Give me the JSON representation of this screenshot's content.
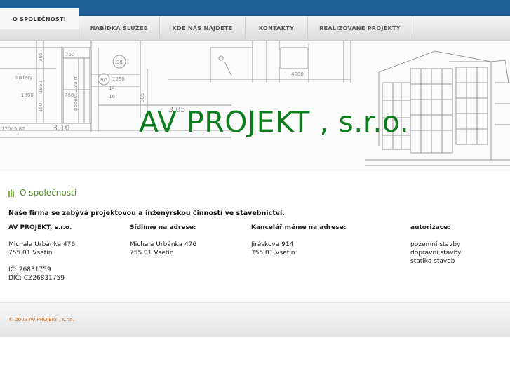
{
  "nav": {
    "tabs": [
      {
        "label": "O SPOLEČNOSTI",
        "active": true
      },
      {
        "label": "NABÍDKA SLUŽEB",
        "active": false
      },
      {
        "label": "KDE NÁS NAJDETE",
        "active": false
      },
      {
        "label": "KONTAKTY",
        "active": false
      },
      {
        "label": "REALIZOVANÉ PROJEKTY",
        "active": false
      }
    ]
  },
  "banner": {
    "title": "AV PROJEKT , s.r.o.",
    "drawing_labels": [
      "750",
      "luxfery",
      "1800",
      "305",
      "1850",
      "150",
      "760",
      "podest 2.30 m",
      "1250",
      "38",
      "8/1",
      "14",
      "16",
      "3.05",
      "3.10",
      "170/ 5.87",
      "305",
      "4000"
    ]
  },
  "content": {
    "heading": "O společnosti",
    "intro": "Naše firma se zabývá projektovou a inženýrskou činností ve stavebnictví.",
    "columns": [
      {
        "title": "AV PROJEKT, s.r.o.",
        "lines": [
          "Michala Urbánka 476",
          "755 01 Vsetín",
          "",
          "IČ: 26831759",
          "DIČ: CZ26831759"
        ]
      },
      {
        "title": "Sídlíme na adrese:",
        "lines": [
          "Michala Urbánka 476",
          "755 01 Vsetín"
        ]
      },
      {
        "title": "Kancelář máme na adrese:",
        "lines": [
          "Jiráskova 914",
          "755 01 Vsetín"
        ]
      },
      {
        "title": "autorizace:",
        "lines": [
          "pozemní stavby",
          "dopravní stavby",
          "statika staveb"
        ]
      }
    ]
  },
  "footer": {
    "text": "© 2009 AV PROJEKT , s.r.o."
  },
  "colors": {
    "topbar": "#1e5f96",
    "title_green": "#0d7d1e",
    "heading_green": "#4c8a1f",
    "footer_orange": "#d0661a"
  }
}
